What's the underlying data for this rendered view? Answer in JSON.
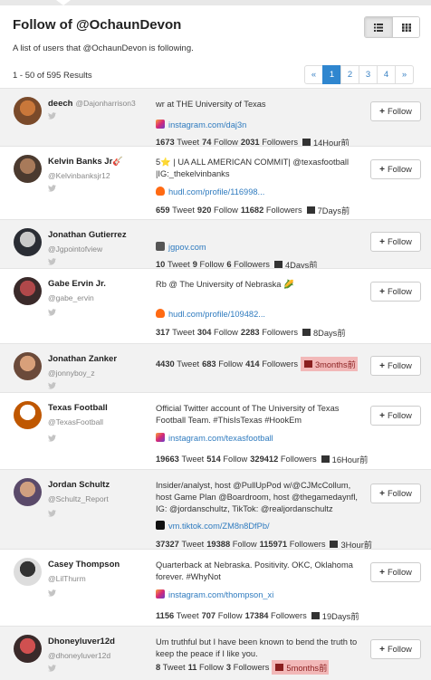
{
  "header": {
    "title": "Follow of @OchaunDevon",
    "subtitle": "A list of users that @OchaunDevon is following.",
    "view_list_icon": "list-icon",
    "view_grid_icon": "grid-icon"
  },
  "results": {
    "text": "1 - 50 of 595 Results"
  },
  "pager": [
    "«",
    "1",
    "2",
    "3",
    "4",
    "»"
  ],
  "follow_label": "Follow",
  "twitter_icon": "twitter-bird-icon",
  "users": [
    {
      "name": "deech",
      "handle": "@Dajonharrison3",
      "bio": "wr at THE University of Texas",
      "link_icon": "instagram-icon",
      "link": "instagram.com/daj3n",
      "tweets": "1673",
      "follows": "74",
      "followers": "2031",
      "time": "14Hour前",
      "highlight": false
    },
    {
      "name": "Kelvin Banks Jr🎸",
      "handle": "@Kelvinbanksjr12",
      "bio": "5⭐️ | UA ALL AMERICAN COMMIT| @texasfootball |IG:_thekelvinbanks",
      "link_icon": "hudl-icon",
      "link": "hudl.com/profile/116998...",
      "tweets": "659",
      "follows": "920",
      "followers": "11682",
      "time": "7Days前",
      "highlight": false
    },
    {
      "name": "Jonathan Gutierrez",
      "handle": "@Jgpointofview",
      "bio": "",
      "link_icon": "cube-icon",
      "link": "jgpov.com",
      "tweets": "10",
      "follows": "9",
      "followers": "6",
      "time": "4Days前",
      "highlight": false
    },
    {
      "name": "Gabe Ervin Jr.",
      "handle": "@gabe_ervin",
      "bio": "Rb @ The University of Nebraska 🌽",
      "link_icon": "hudl-icon",
      "link": "hudl.com/profile/109482...",
      "tweets": "317",
      "follows": "304",
      "followers": "2283",
      "time": "8Days前",
      "highlight": false
    },
    {
      "name": "Jonathan Zanker",
      "handle": "@jonnyboy_z",
      "bio": "",
      "link_icon": "",
      "link": "",
      "tweets": "4430",
      "follows": "683",
      "followers": "414",
      "time": "3months前",
      "highlight": true
    },
    {
      "name": "Texas Football",
      "handle": "@TexasFootball",
      "bio": "Official Twitter account of The University of Texas Football Team. #ThisIsTexas #HookEm",
      "link_icon": "instagram-icon",
      "link": "instagram.com/texasfootball",
      "tweets": "19663",
      "follows": "514",
      "followers": "329412",
      "time": "16Hour前",
      "highlight": false
    },
    {
      "name": "Jordan Schultz",
      "handle": "@Schultz_Report",
      "bio": "Insider/analyst, host @PullUpPod w/@CJMcCollum, host Game Plan @Boardroom, host @thegamedaynfl, IG: @jordanschultz, TikTok: @realjordanschultz",
      "link_icon": "tiktok-icon",
      "link": "vm.tiktok.com/ZM8n8DfPb/",
      "tweets": "37327",
      "follows": "19388",
      "followers": "115971",
      "time": "3Hour前",
      "highlight": false
    },
    {
      "name": "Casey Thompson",
      "handle": "@LilThurm",
      "bio": "Quarterback at Nebraska. Positivity. OKC, Oklahoma forever. #WhyNot",
      "link_icon": "instagram-icon",
      "link": "instagram.com/thompson_xi",
      "tweets": "1156",
      "follows": "707",
      "followers": "17384",
      "time": "19Days前",
      "highlight": false
    },
    {
      "name": "Dhoneyluver12d",
      "handle": "@dhoneyluver12d",
      "bio": "Um truthful but I have been known to bend the truth to keep the peace if I like you.",
      "link_icon": "",
      "link": "",
      "tweets": "8",
      "follows": "11",
      "followers": "3",
      "time": "5months前",
      "highlight": true
    }
  ],
  "labels": {
    "tweet": "Tweet",
    "follow": "Follow",
    "followers": "Followers"
  },
  "colors": {
    "accent": "#2f86cf",
    "highlight_bg": "#f2b8b8",
    "link": "#2f7bbf"
  }
}
